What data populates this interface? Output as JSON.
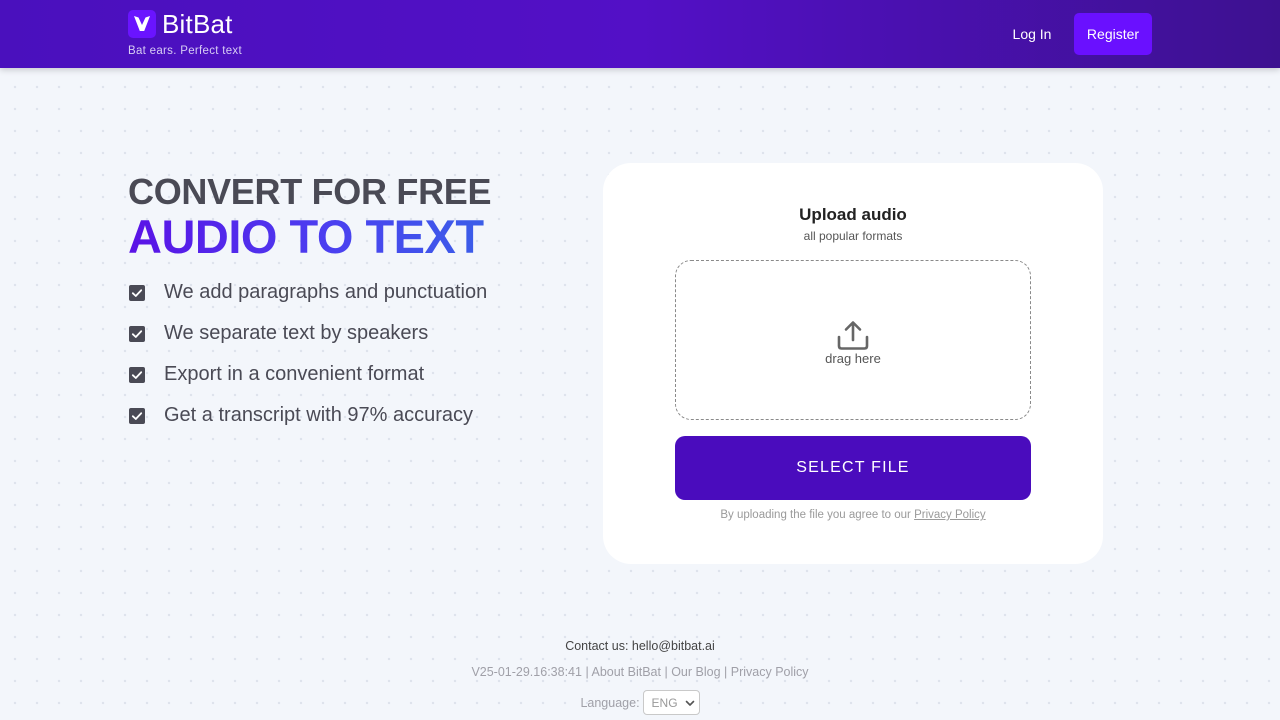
{
  "header": {
    "brand_name": "BitBat",
    "tagline": "Bat ears. Perfect text",
    "login_label": "Log In",
    "register_label": "Register",
    "logo_icon": "bat-logo-icon",
    "colors": {
      "header_start": "#4a10bd",
      "header_end": "#3d1190",
      "register_bg": "#6a10ff"
    }
  },
  "hero": {
    "title_top": "CONVERT FOR FREE",
    "title_main": "AUDIO TO TEXT",
    "features": [
      "We add paragraphs and punctuation",
      "We separate text by speakers",
      "Export in a convenient format",
      "Get a transcript with 97% accuracy"
    ],
    "feature_icon": "checkbox-checked-icon"
  },
  "upload": {
    "title": "Upload audio",
    "subtitle": "all popular formats",
    "drop_text": "drag here",
    "drop_icon": "upload-icon",
    "select_button": "SELECT FILE",
    "agree_text": "By uploading the file you agree to our",
    "privacy_link": "Privacy Policy",
    "colors": {
      "button_bg": "#4a0cbd"
    }
  },
  "footer": {
    "contact_label": "Contact us:",
    "contact_email": "hello@bitbat.ai",
    "version": "V25-01-29.16:38:41",
    "about_link": "About BitBat",
    "blog_link": "Our Blog",
    "privacy_link": "Privacy Policy",
    "language_label": "Language:",
    "language_value": "ENG"
  }
}
